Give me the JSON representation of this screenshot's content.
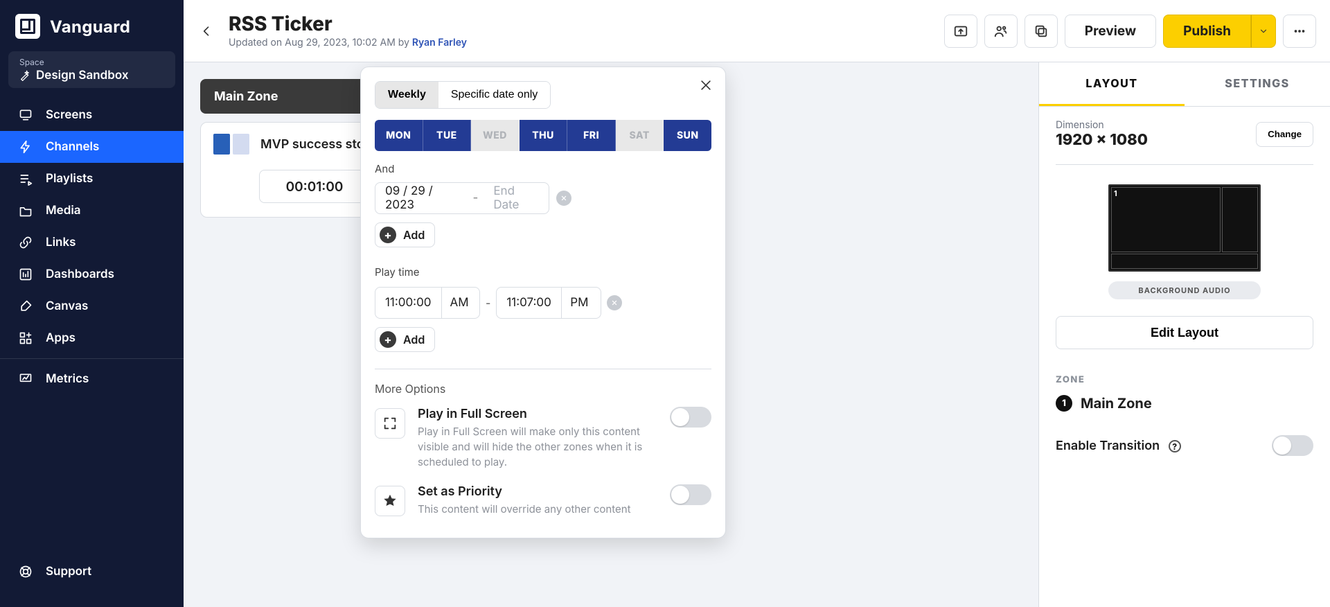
{
  "brand": {
    "name": "Vanguard"
  },
  "space": {
    "label": "Space",
    "value": "Design Sandbox"
  },
  "nav": {
    "items": [
      {
        "label": "Screens"
      },
      {
        "label": "Channels"
      },
      {
        "label": "Playlists"
      },
      {
        "label": "Media"
      },
      {
        "label": "Links"
      },
      {
        "label": "Dashboards"
      },
      {
        "label": "Canvas"
      },
      {
        "label": "Apps"
      }
    ],
    "metrics": "Metrics",
    "support": "Support"
  },
  "page": {
    "title": "RSS Ticker",
    "updated_prefix": "Updated on ",
    "updated_date": "Aug 29, 2023, 10:02 AM",
    "by": " by ",
    "user": "Ryan Farley"
  },
  "topbar": {
    "preview": "Preview",
    "publish": "Publish"
  },
  "zone_header": "Main Zone",
  "content_item": {
    "title": "MVP success story",
    "duration": "00:01:00"
  },
  "popover": {
    "mode_weekly": "Weekly",
    "mode_specific": "Specific date only",
    "days": [
      {
        "code": "MON",
        "on": true
      },
      {
        "code": "TUE",
        "on": true
      },
      {
        "code": "WED",
        "on": false
      },
      {
        "code": "THU",
        "on": true
      },
      {
        "code": "FRI",
        "on": true
      },
      {
        "code": "SAT",
        "on": false
      },
      {
        "code": "SUN",
        "on": true
      }
    ],
    "and_label": "And",
    "date_start": "09 / 29 / 2023",
    "date_end_placeholder": "End Date",
    "add": "Add",
    "play_time_label": "Play time",
    "time_start": "11:00:00",
    "time_start_mer": "AM",
    "time_end": "11:07:00",
    "time_end_mer": "PM",
    "more_options": "More Options",
    "opt_fullscreen_title": "Play in Full Screen",
    "opt_fullscreen_desc": "Play in Full Screen will make only this content visible and will hide the other zones when it is scheduled to play.",
    "opt_priority_title": "Set as Priority",
    "opt_priority_desc": "This content will override any other content"
  },
  "right": {
    "tab_layout": "LAYOUT",
    "tab_settings": "SETTINGS",
    "dimension_label": "Dimension",
    "dimension_value": "1920 × 1080",
    "change": "Change",
    "bg_audio": "BACKGROUND AUDIO",
    "edit_layout": "Edit Layout",
    "zone_label": "ZONE",
    "zone_number": "1",
    "zone_name": "Main Zone",
    "enable_transition": "Enable Transition"
  }
}
